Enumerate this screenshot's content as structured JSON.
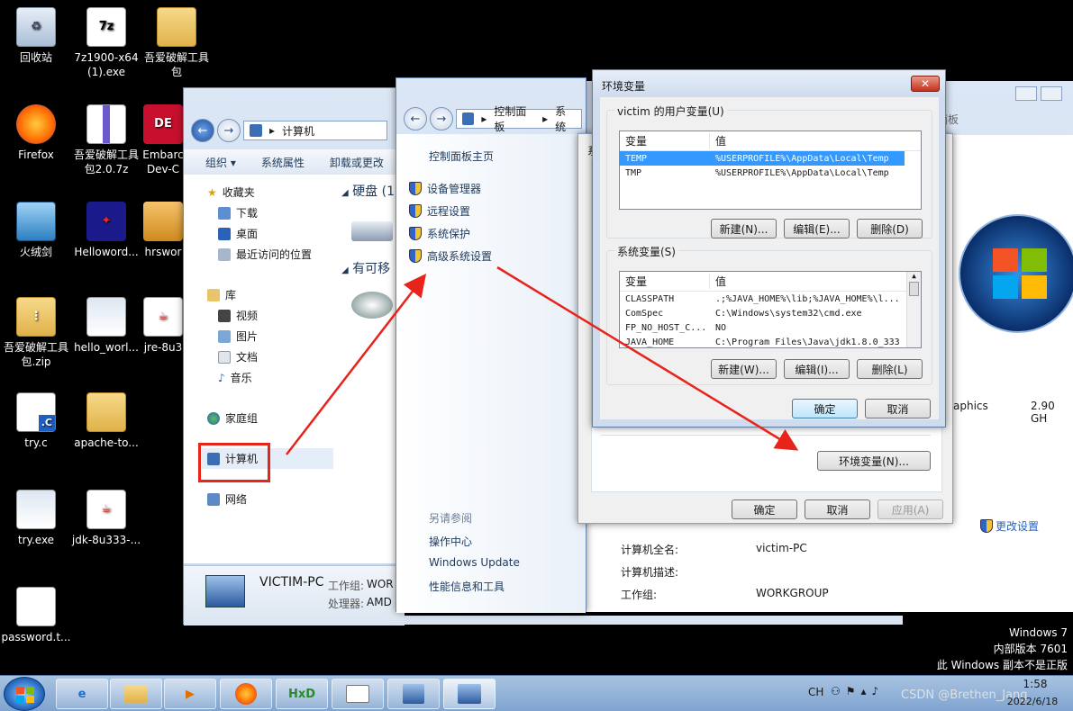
{
  "desktop": {
    "icons": [
      {
        "label": "回收站",
        "glyph": "recycle-bin-icon"
      },
      {
        "label": "7z1900-x64 (1).exe",
        "glyph": "7z-icon"
      },
      {
        "label": "吾爱破解工具包",
        "glyph": "folder-icon"
      },
      {
        "label": "Firefox",
        "glyph": "firefox-icon"
      },
      {
        "label": "吾爱破解工具包2.0.7z",
        "glyph": "archive-icon"
      },
      {
        "label": "Embarc Dev-C",
        "glyph": "devc-icon"
      },
      {
        "label": "火绒剑",
        "glyph": "huorong-icon"
      },
      {
        "label": "Helloword...",
        "glyph": "helloword-icon"
      },
      {
        "label": "hrswor",
        "glyph": "installer-icon"
      },
      {
        "label": "吾爱破解工具包.zip",
        "glyph": "zip-icon"
      },
      {
        "label": "hello_worl...",
        "glyph": "app-icon"
      },
      {
        "label": "jre-8u3",
        "glyph": "java-icon"
      },
      {
        "label": "try.c",
        "glyph": "c-file-icon"
      },
      {
        "label": "apache-to...",
        "glyph": "folder-icon"
      },
      {
        "label": "try.exe",
        "glyph": "exe-icon"
      },
      {
        "label": "jdk-8u333-...",
        "glyph": "java-icon"
      },
      {
        "label": "password.t...",
        "glyph": "text-file-icon"
      }
    ]
  },
  "explorer": {
    "breadcrumb": "计算机",
    "toolbar": [
      "组织 ▾",
      "系统属性",
      "卸载或更改"
    ],
    "nav": {
      "favorites": "收藏夹",
      "favorites_items": [
        "下载",
        "桌面",
        "最近访问的位置"
      ],
      "libraries": "库",
      "library_items": [
        "视频",
        "图片",
        "文档",
        "音乐"
      ],
      "homegroup": "家庭组",
      "computer": "计算机",
      "network": "网络"
    },
    "groups": {
      "hdd": "硬盘 (1",
      "removable": "有可移"
    },
    "details": {
      "name": "VICTIM-PC",
      "workgroup_label": "工作组:",
      "workgroup": "WOR",
      "cpu_label": "处理器:",
      "cpu": "AMD"
    }
  },
  "control_panel": {
    "breadcrumb": [
      "控制面板",
      "系统"
    ],
    "home": "控制面板主页",
    "links": [
      "设备管理器",
      "远程设置",
      "系统保护",
      "高级系统设置"
    ],
    "see_also": "另请参阅",
    "see_also_links": [
      "操作中心",
      "Windows Update",
      "性能信息和工具"
    ],
    "right_text": {
      "graphics": "aphics",
      "ghz": "2.90 GH",
      "change_settings": "更改设置",
      "computer_full_name_label": "计算机全名:",
      "computer_full_name": "victim-PC",
      "computer_desc_label": "计算机描述:",
      "workgroup_label": "工作组:",
      "workgroup": "WORKGROUP",
      "behind_crumb": "面板"
    }
  },
  "sys_props": {
    "tab_prefix": "系",
    "env_button": "环境变量(N)...",
    "ok": "确定",
    "cancel": "取消",
    "apply": "应用(A)"
  },
  "env_dialog": {
    "title": "环境变量",
    "user_group": "victim 的用户变量(U)",
    "col_var": "变量",
    "col_val": "值",
    "user_vars": [
      {
        "name": "TEMP",
        "value": "%USERPROFILE%\\AppData\\Local\\Temp"
      },
      {
        "name": "TMP",
        "value": "%USERPROFILE%\\AppData\\Local\\Temp"
      }
    ],
    "user_buttons": [
      "新建(N)...",
      "编辑(E)...",
      "删除(D)"
    ],
    "sys_group": "系统变量(S)",
    "sys_vars": [
      {
        "name": "CLASSPATH",
        "value": ".;%JAVA_HOME%\\lib;%JAVA_HOME%\\l..."
      },
      {
        "name": "ComSpec",
        "value": "C:\\Windows\\system32\\cmd.exe"
      },
      {
        "name": "FP_NO_HOST_C...",
        "value": "NO"
      },
      {
        "name": "JAVA_HOME",
        "value": "C:\\Program Files\\Java\\jdk1.8.0_333"
      }
    ],
    "sys_buttons": [
      "新建(W)...",
      "编辑(I)...",
      "删除(L)"
    ],
    "ok": "确定",
    "cancel": "取消"
  },
  "watermark": {
    "line1": "Windows 7",
    "line2": "内部版本 7601",
    "line3": "此 Windows 副本不是正版"
  },
  "taskbar": {
    "lang": "CH",
    "time": "1:58",
    "date": "2022/6/18",
    "csdn": "CSDN @Brethen_Jang"
  },
  "colors": {
    "annotation_red": "#e8231a",
    "selection": "#3399ff"
  }
}
